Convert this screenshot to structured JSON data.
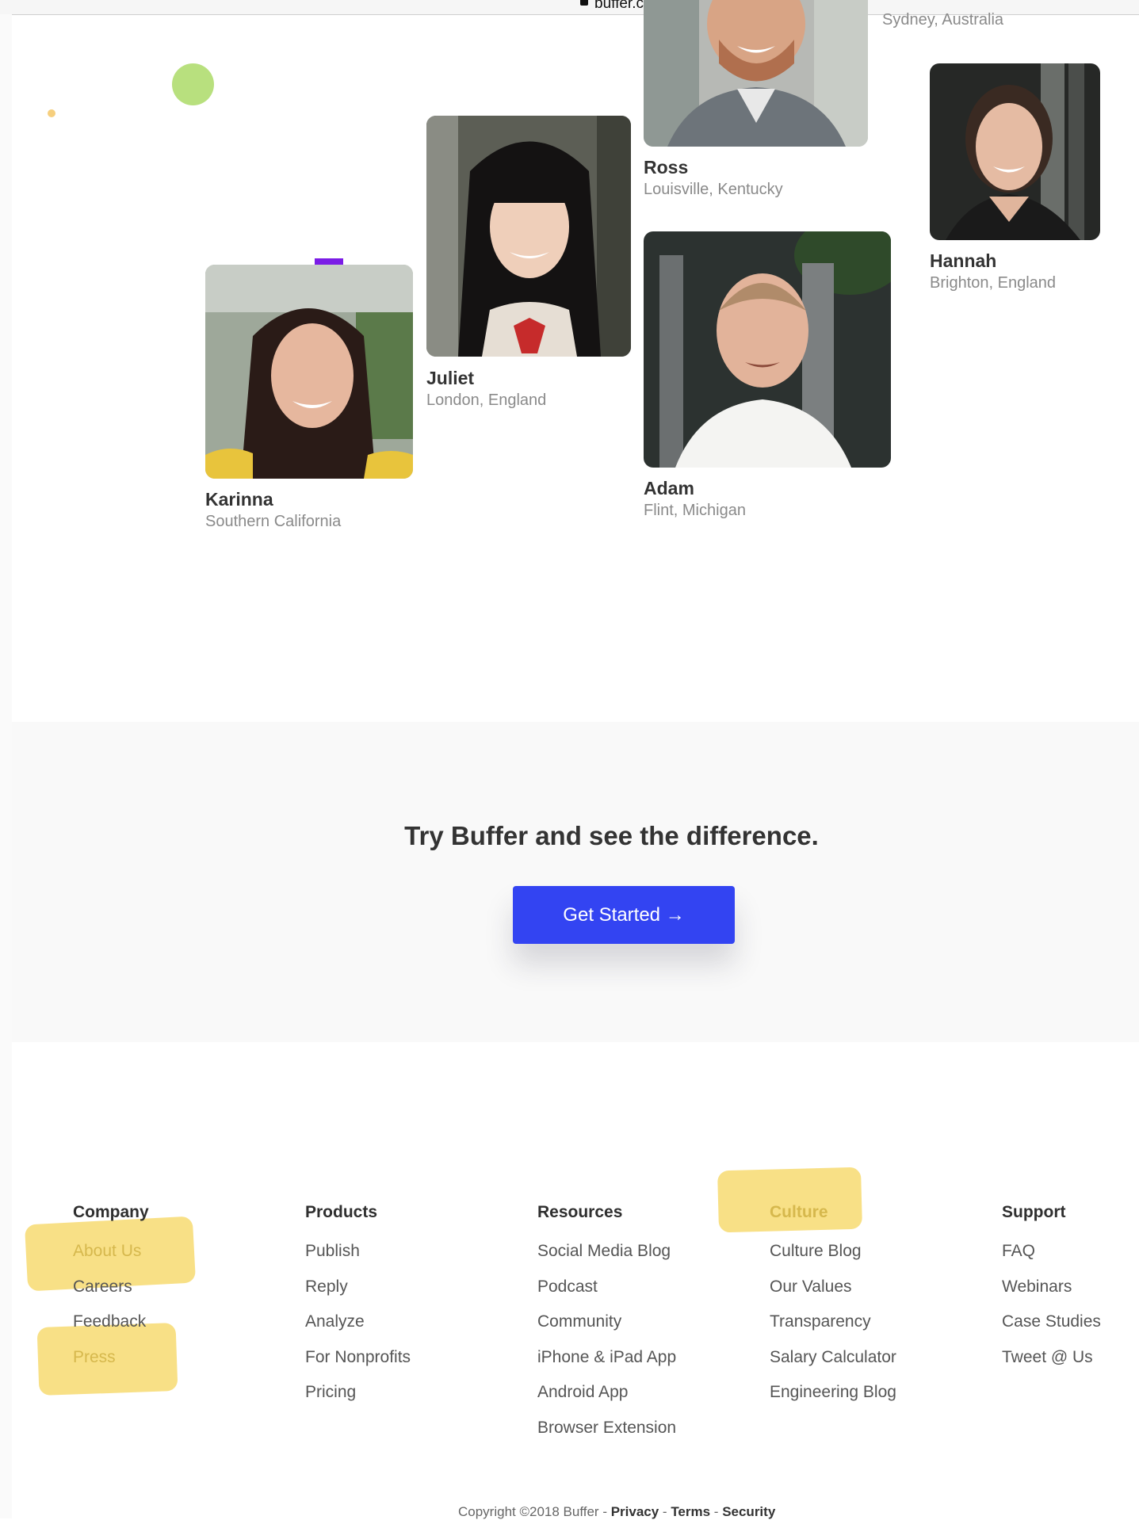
{
  "browser": {
    "domain": "buffer.com"
  },
  "team": [
    {
      "name": "Ross",
      "location": "Louisville, Kentucky"
    },
    {
      "name": "Hannah",
      "location": "Brighton, England"
    },
    {
      "name": "Juliet",
      "location": "London, England"
    },
    {
      "name": "Adam",
      "location": "Flint, Michigan"
    },
    {
      "name": "Karinna",
      "location": "Southern California"
    }
  ],
  "partial_location": "Sydney, Australia",
  "cta": {
    "title": "Try Buffer and see the difference.",
    "button": "Get Started →"
  },
  "footer": {
    "columns": [
      {
        "heading": "Company",
        "links": [
          "About Us",
          "Careers",
          "Feedback",
          "Press"
        ]
      },
      {
        "heading": "Products",
        "links": [
          "Publish",
          "Reply",
          "Analyze",
          "For Nonprofits",
          "Pricing"
        ]
      },
      {
        "heading": "Resources",
        "links": [
          "Social Media Blog",
          "Podcast",
          "Community",
          "iPhone & iPad App",
          "Android App",
          "Browser Extension"
        ]
      },
      {
        "heading": "Culture",
        "links": [
          "Culture Blog",
          "Our Values",
          "Transparency",
          "Salary Calculator",
          "Engineering Blog"
        ]
      },
      {
        "heading": "Support",
        "links": [
          "FAQ",
          "Webinars",
          "Case Studies",
          "Tweet @ Us"
        ]
      }
    ],
    "copyright": {
      "text": "Copyright ©2018 Buffer - ",
      "privacy": "Privacy",
      "terms": "Terms",
      "security": "Security",
      "sep": " - "
    }
  },
  "colors": {
    "accent": "#3344f2",
    "highlight": "#f7dd79",
    "green_dot": "#b8e07e",
    "purple": "#7b1ce6"
  }
}
